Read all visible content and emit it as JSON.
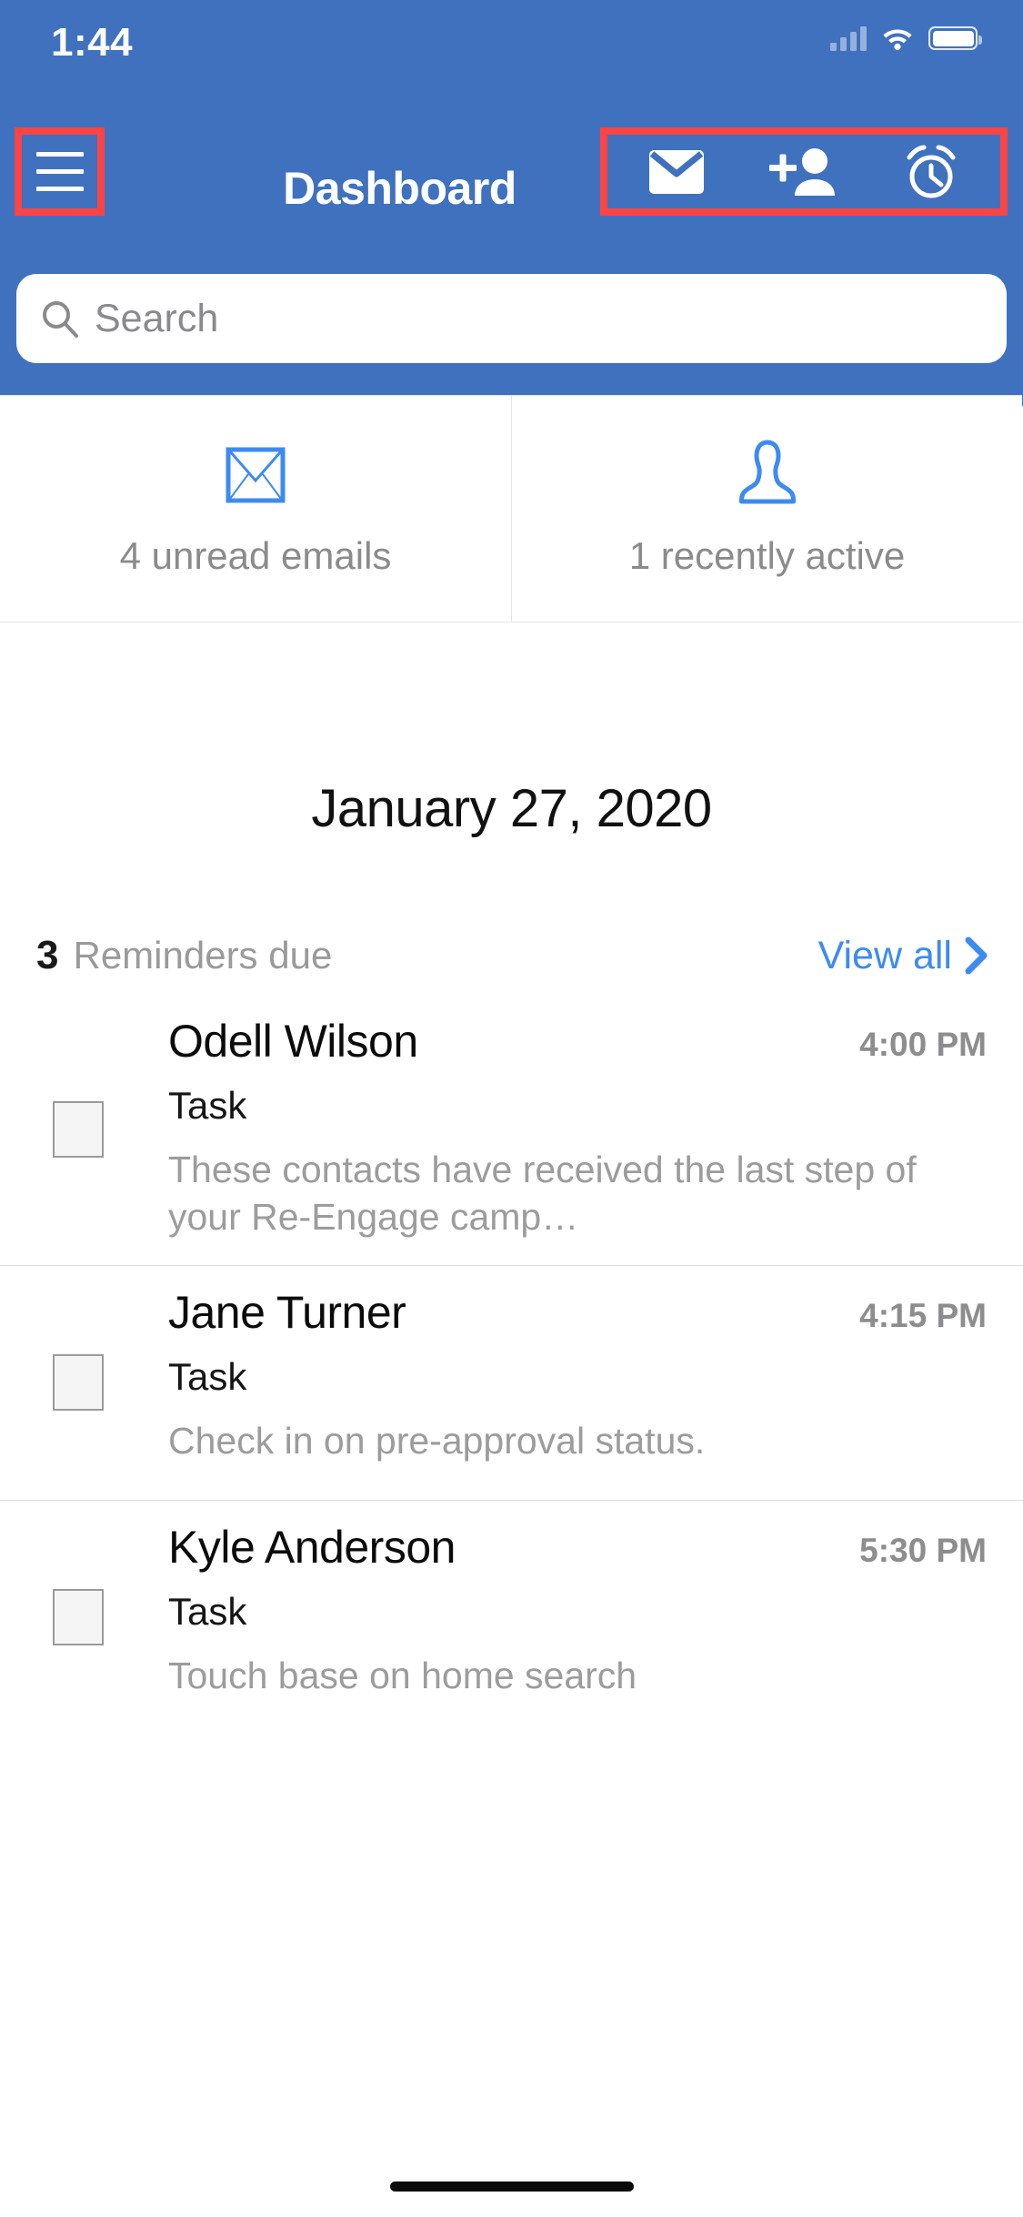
{
  "status_bar": {
    "time": "1:44",
    "signal_icon": "cellular-signal-icon",
    "wifi_icon": "wifi-icon",
    "battery_icon": "battery-icon"
  },
  "nav": {
    "menu_icon": "hamburger-menu-icon",
    "title": "Dashboard",
    "actions": [
      {
        "name": "mail-icon",
        "label": "Mail"
      },
      {
        "name": "add-person-icon",
        "label": "Add contact"
      },
      {
        "name": "alarm-clock-icon",
        "label": "Reminders"
      }
    ],
    "highlight_color": "#fc4444"
  },
  "search": {
    "placeholder": "Search",
    "value": "",
    "icon": "search-icon"
  },
  "stats": [
    {
      "icon": "envelope-outline-icon",
      "label": "4 unread emails"
    },
    {
      "icon": "person-outline-icon",
      "label": "1 recently active"
    }
  ],
  "date_title": "January 27, 2020",
  "reminders_header": {
    "count": "3",
    "label": "Reminders due",
    "view_all_label": "View all",
    "chevron_icon": "chevron-right-icon",
    "link_color": "#3d8bf2"
  },
  "reminders": [
    {
      "name": "Odell Wilson",
      "time": "4:00 PM",
      "type": "Task",
      "description": "These contacts have received the last step of your Re-Engage camp…",
      "checkbox": "unchecked"
    },
    {
      "name": "Jane Turner",
      "time": "4:15 PM",
      "type": "Task",
      "description": "Check in on pre-approval status.",
      "checkbox": "unchecked"
    },
    {
      "name": "Kyle Anderson",
      "time": "5:30 PM",
      "type": "Task",
      "description": "Touch base on home search",
      "checkbox": "unchecked"
    }
  ],
  "theme": {
    "header_blue": "#3f71bf",
    "accent_blue": "#3d8bf2",
    "annotation_red": "#fc4444"
  }
}
